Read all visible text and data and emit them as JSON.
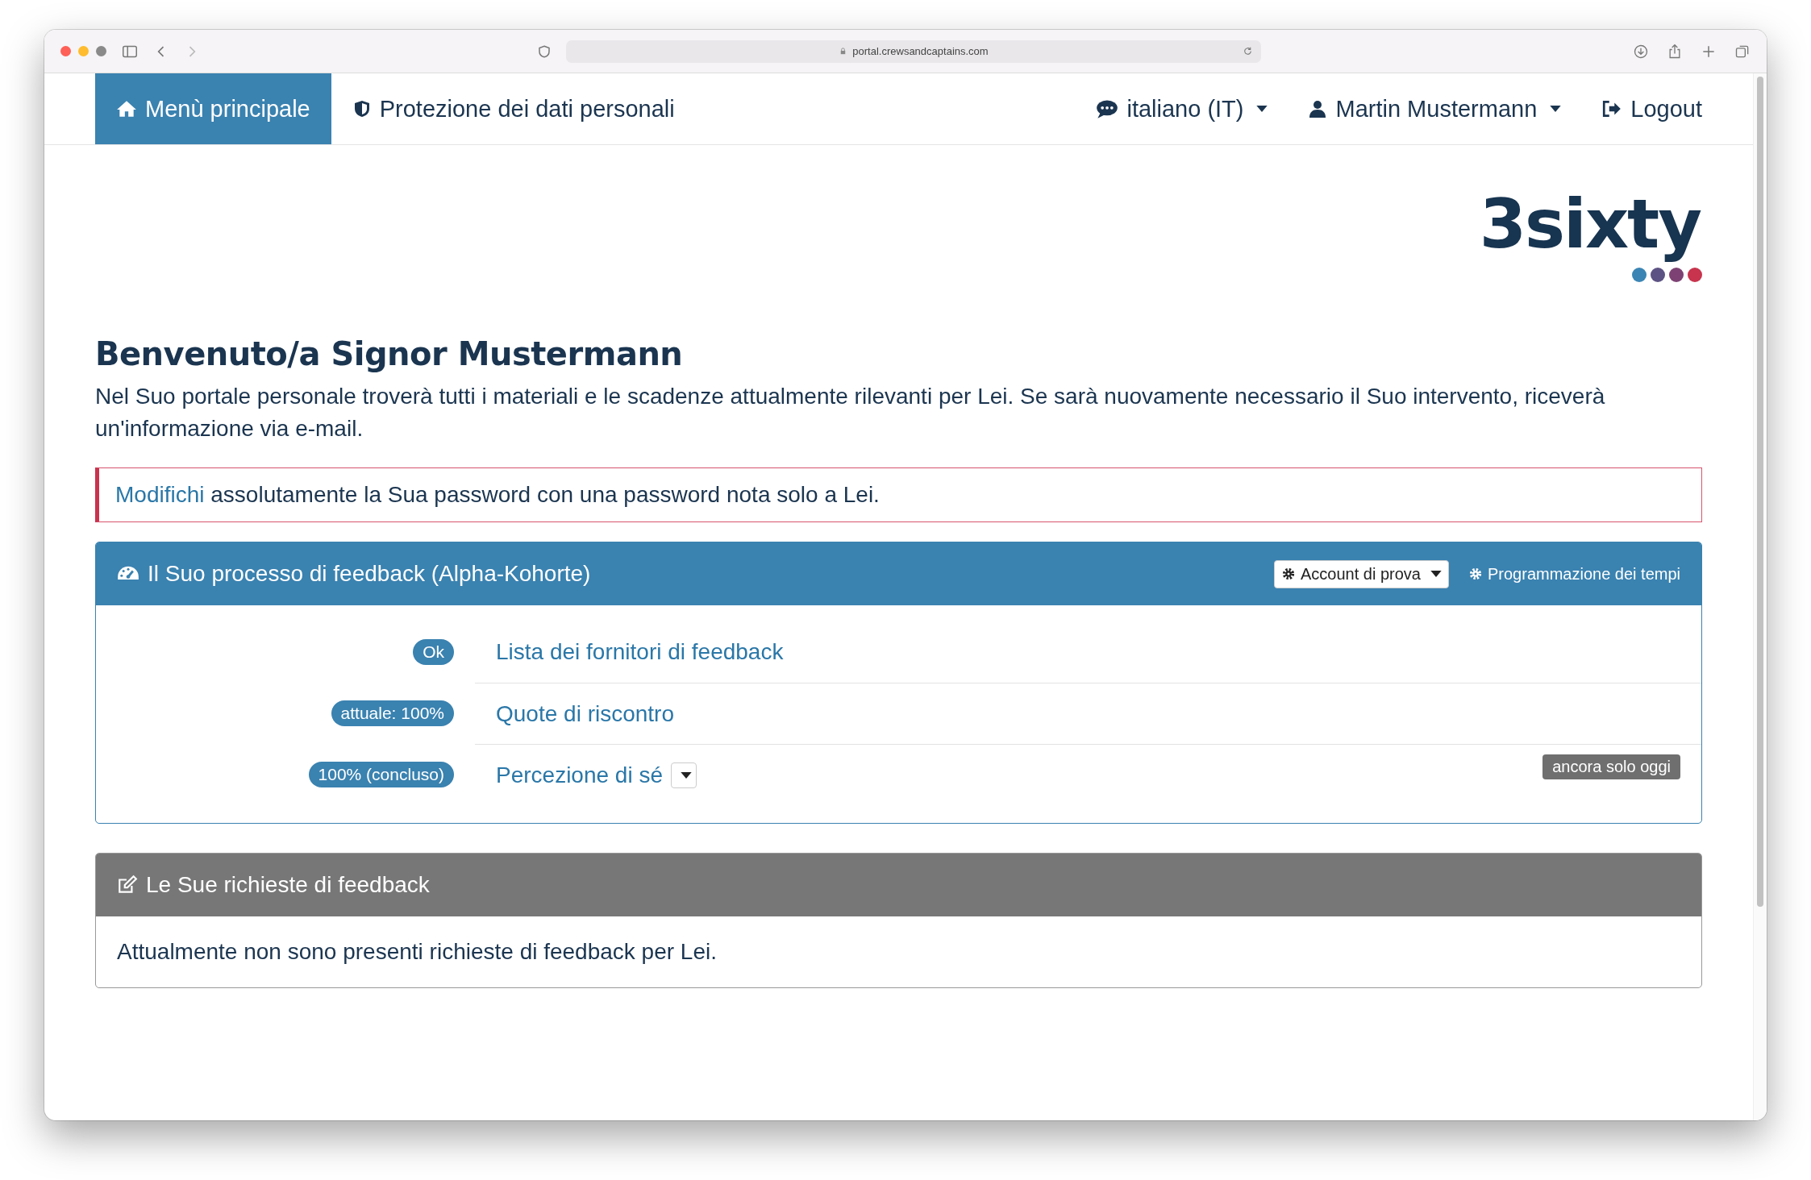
{
  "browser": {
    "url": "portal.crewsandcaptains.com"
  },
  "nav": {
    "home": {
      "label": "Menù principale",
      "selected": true
    },
    "privacy": {
      "label": "Protezione dei dati personali",
      "selected": false
    },
    "language": {
      "label": "italiano (IT)"
    },
    "user": {
      "label": "Martin Mustermann"
    },
    "logout": {
      "label": "Logout"
    }
  },
  "logo": {
    "text": "3sixty",
    "dots": [
      {
        "color": "#3a85b4"
      },
      {
        "color": "#5c5283"
      },
      {
        "color": "#7d4273"
      },
      {
        "color": "#c8334d"
      }
    ]
  },
  "welcome": {
    "title": "Benvenuto/a Signor Mustermann",
    "text": "Nel Suo portale personale troverà tutti i materiali e le scadenze attualmente rilevanti per Lei. Se sarà nuovamente necessario il Suo intervento, riceverà un'informazione via e-mail."
  },
  "alert": {
    "link": "Modifichi",
    "text": "assolutamente la Sua password con una password nota solo a Lei."
  },
  "feedback_panel": {
    "title": "Il Suo processo di feedback (Alpha-Kohorte)",
    "account_button": "Account di prova",
    "schedule_link": "Programmazione dei tempi",
    "rows": [
      {
        "badge": "Ok",
        "link": "Lista dei fornitori di feedback",
        "dropdown": false
      },
      {
        "badge": "attuale: 100%",
        "link": "Quote di riscontro",
        "dropdown": false
      },
      {
        "badge": "100% (concluso)",
        "link": "Percezione di sé",
        "dropdown": true,
        "deadline": "ancora solo oggi"
      }
    ]
  },
  "requests_panel": {
    "title": "Le Sue richieste di feedback",
    "text": "Attualmente non sono presenti richieste di feedback per Lei."
  }
}
